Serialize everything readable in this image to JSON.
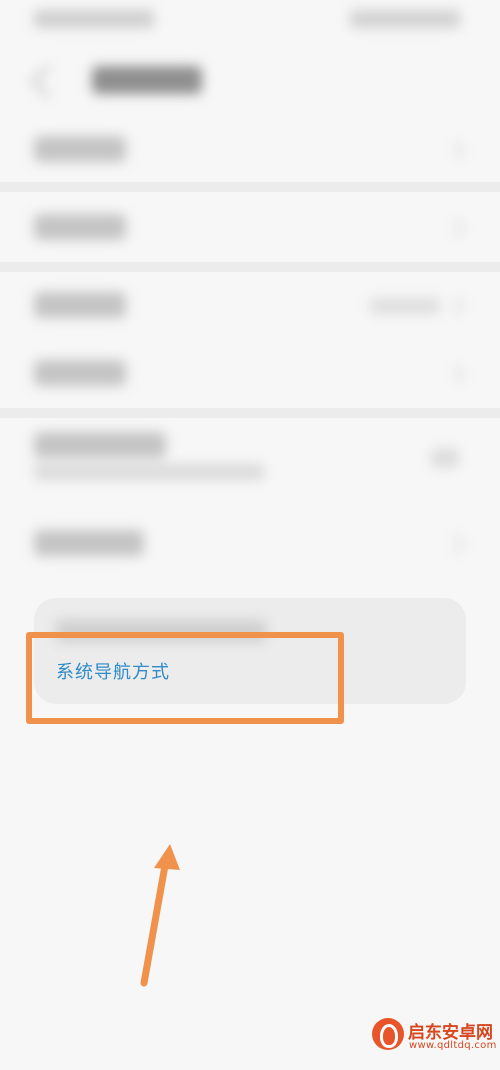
{
  "tip": {
    "link_label": "系统导航方式"
  },
  "watermark": {
    "brand": "启东安卓网",
    "url": "www.qdltdq.com"
  },
  "colors": {
    "link": "#2f8bc9",
    "highlight": "#f0924b",
    "watermark": "#d6461f"
  },
  "icons": [
    "back-icon",
    "chevron-right-icon",
    "toggle-switch",
    "arrow-annotation",
    "watermark-logo-icon"
  ]
}
